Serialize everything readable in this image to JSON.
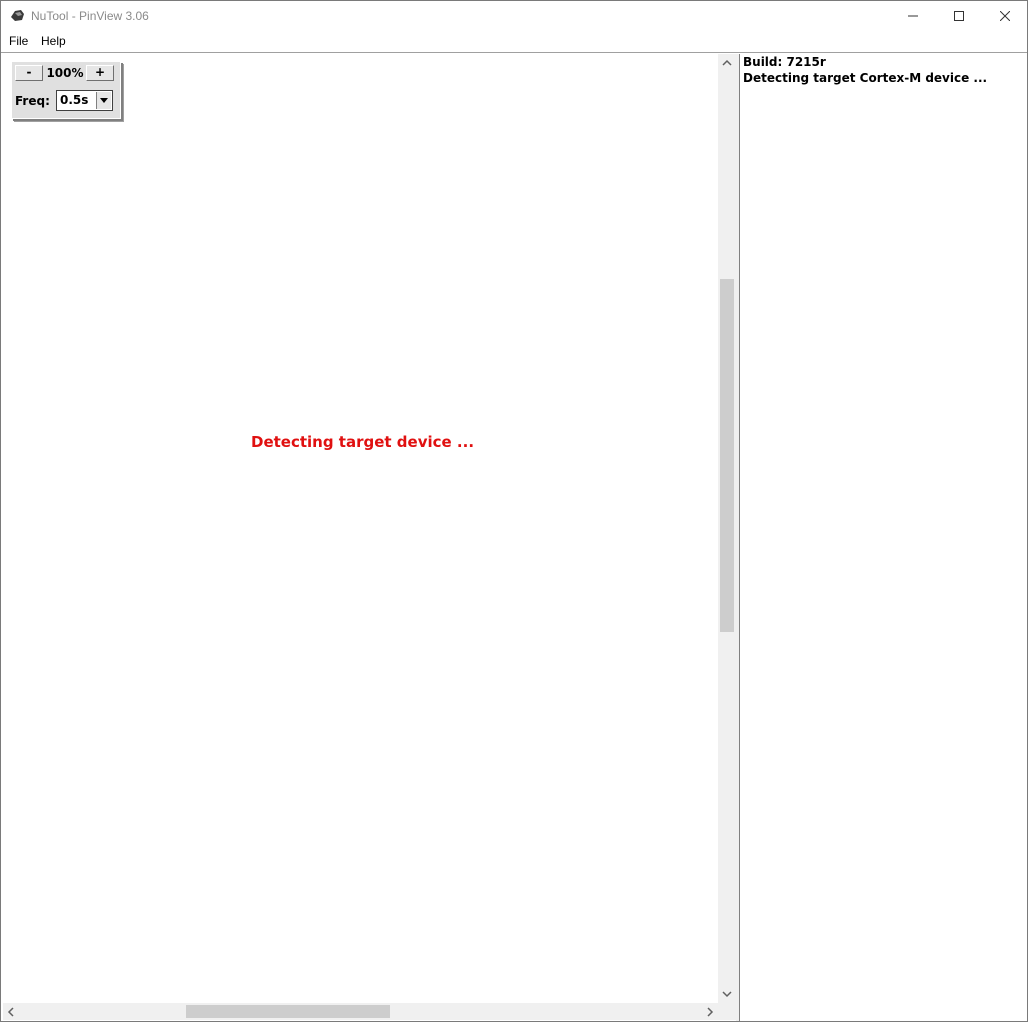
{
  "window": {
    "title": "NuTool - PinView 3.06",
    "icon": "nutool-app-icon",
    "controls": {
      "minimize_icon": "minimize-icon",
      "maximize_icon": "maximize-icon",
      "close_icon": "close-icon"
    }
  },
  "menubar": {
    "items": [
      {
        "label": "File"
      },
      {
        "label": "Help"
      }
    ]
  },
  "toolbox": {
    "zoom_out_label": "-",
    "zoom_level": "100%",
    "zoom_in_label": "+",
    "freq_label": "Freq:",
    "freq_value": "0.5s"
  },
  "main": {
    "status_message": "Detecting target device ...",
    "status_color": "#e01010"
  },
  "log": {
    "lines": [
      "Build: 7215r",
      "Detecting target Cortex-M device ..."
    ]
  }
}
